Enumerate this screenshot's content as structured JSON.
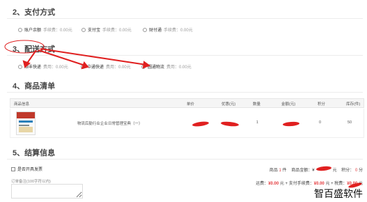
{
  "payment": {
    "title": "2、支付方式",
    "options": [
      {
        "name": "账户余额",
        "fee": "手续费：0.00元"
      },
      {
        "name": "支付宝",
        "fee": "手续费：0.00元"
      },
      {
        "name": "财付通",
        "fee": "手续费：0.00元"
      }
    ]
  },
  "shipping": {
    "title": "3、配送方式",
    "options": [
      {
        "name": "顺丰快递",
        "fee": "费用：0.00元"
      },
      {
        "name": "中通快递",
        "fee": "费用：0.00元"
      },
      {
        "name": "圆通物流",
        "fee": "费用：0.00元"
      }
    ]
  },
  "goods": {
    "title": "4、商品清单",
    "headers": {
      "info": "商品信息",
      "unit_price": "单价",
      "discount": "优惠(元)",
      "quantity": "数量",
      "amount": "金额(元)",
      "points": "积分",
      "stock": "库存(件)"
    },
    "rows": [
      {
        "name": "物流后勤行业企业日常管理宝典（一）",
        "quantity": "1",
        "points": "0",
        "stock": "50"
      }
    ]
  },
  "settlement": {
    "title": "5、结算信息",
    "invoice_label": "是否开具发票",
    "note_label": "订单备注(100字符以内)",
    "summary1": {
      "goods_prefix": "商品",
      "goods_count": "1",
      "goods_unit": "件",
      "amount_label": "商品金额：",
      "amount_currency": "¥",
      "amount_suffix": "元",
      "points_label": "积分：",
      "points_value": "0",
      "points_unit": "分"
    },
    "summary2": {
      "shipping_label": "运费：",
      "shipping_value": "¥0.00",
      "shipping_unit": "元 +",
      "fee_label": "支付手续费：",
      "fee_value": "¥0.00",
      "fee_unit": "元 +",
      "tax_label": "税费：",
      "tax_value": "¥0.00",
      "tax_unit": "元"
    }
  },
  "watermark": "智百盛软件",
  "colors": {
    "accent_red": "#e4393c",
    "annotation_red": "#e02020"
  }
}
